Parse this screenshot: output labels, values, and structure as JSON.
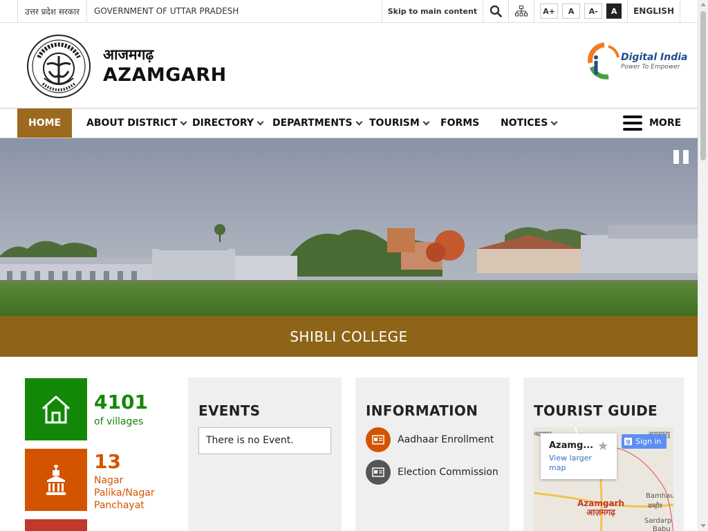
{
  "topbar": {
    "gov_hindi": "उत्तर प्रदेश सरकार",
    "gov_english": "GOVERNMENT OF UTTAR PRADESH",
    "skip_link": "Skip to main content",
    "font_increase": "A+",
    "font_normal": "A",
    "font_decrease": "A-",
    "contrast": "A",
    "language": "ENGLISH"
  },
  "header": {
    "title_hindi": "आजमगढ़",
    "title_english": "AZAMGARH",
    "digital_india_title": "Digital India",
    "digital_india_tagline": "Power To Empower"
  },
  "nav": {
    "items": [
      {
        "label": "HOME"
      },
      {
        "label": "ABOUT DISTRICT"
      },
      {
        "label": "DIRECTORY"
      },
      {
        "label": "DEPARTMENTS"
      },
      {
        "label": "TOURISM"
      },
      {
        "label": "FORMS"
      },
      {
        "label": "NOTICES"
      }
    ],
    "more_label": "MORE"
  },
  "banner": {
    "caption": "SHIBLI COLLEGE"
  },
  "stats": [
    {
      "number": "4101",
      "label": "of villages",
      "color": "#138808"
    },
    {
      "number": "13",
      "label": "Nagar Palika/Nagar Panchayat",
      "color": "#d35400"
    },
    {
      "color": "#c0392b"
    }
  ],
  "events": {
    "title": "EVENTS",
    "empty_text": "There is no Event."
  },
  "information": {
    "title": "INFORMATION",
    "items": [
      {
        "label": "Aadhaar Enrollment",
        "color": "#d35400"
      },
      {
        "label": "Election Commission",
        "color": "#555555"
      }
    ]
  },
  "tourist_guide": {
    "title": "TOURIST GUIDE",
    "map": {
      "place_name": "Azamg...",
      "view_larger": "View larger map",
      "sign_in": "Sign in",
      "city_label": "Azamgarh",
      "city_label_hindi": "आज़मगढ़",
      "place_top_left": "न्धारपुर",
      "place_top_right": "अशरफपु",
      "place_right_1": "Bamhau",
      "place_right_1_hi": "बम्हौर",
      "place_right_2": "Sardarp",
      "place_right_2_b": "Babu"
    }
  },
  "colors": {
    "accent_brown": "#9b6a1f",
    "caption_bg": "#8e6418",
    "card_bg": "#efefef"
  }
}
